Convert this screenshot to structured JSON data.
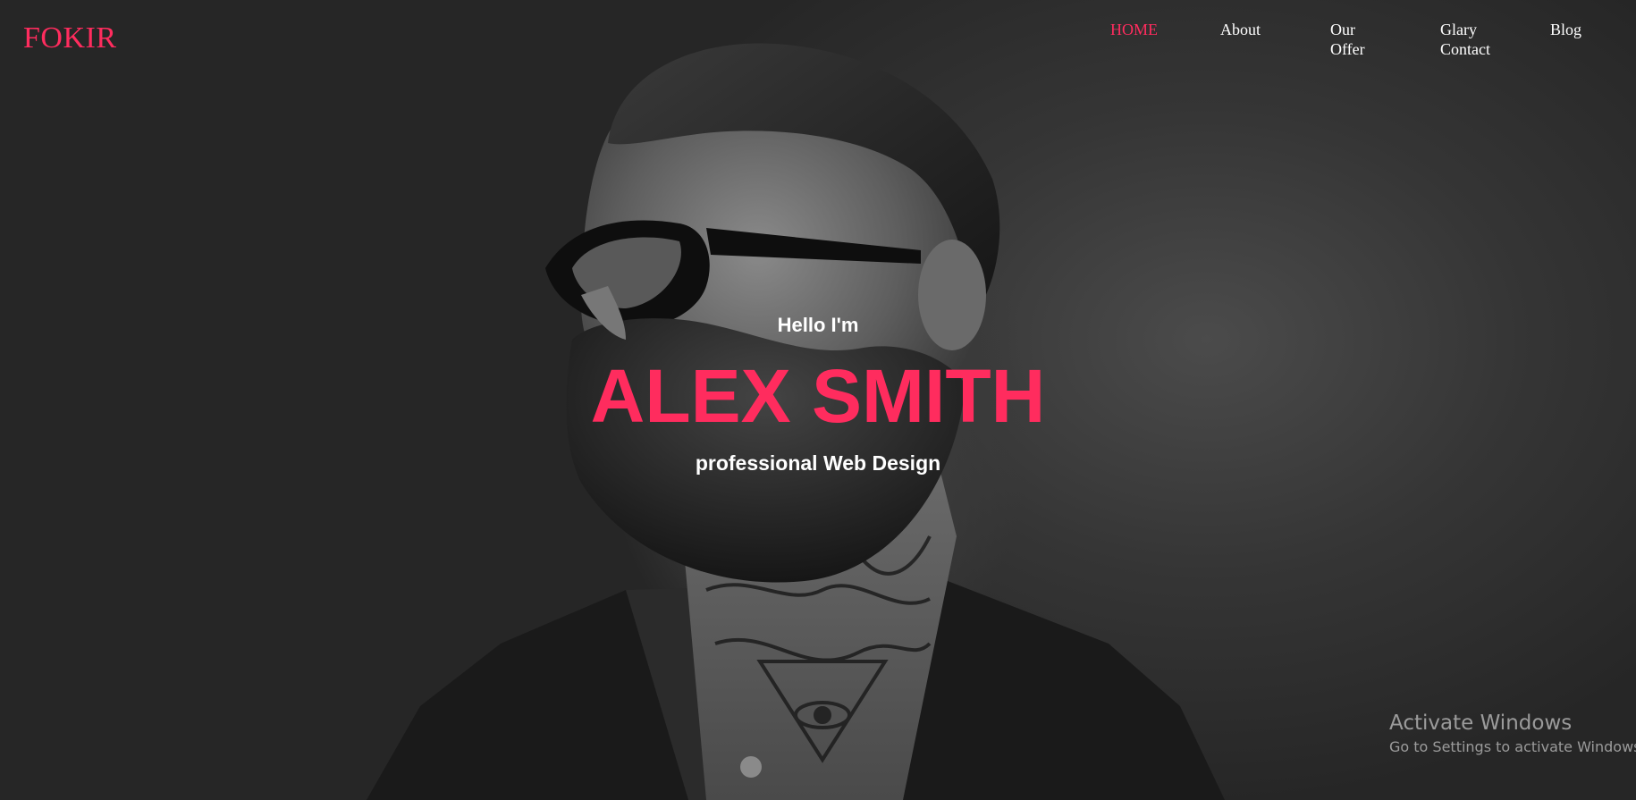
{
  "header": {
    "brand": "FOKIR",
    "nav": [
      {
        "label": "HOME",
        "active": true
      },
      {
        "label": "About",
        "active": false
      },
      {
        "label": "Our Offer",
        "active": false
      },
      {
        "label": "Glary Contact",
        "active": false
      },
      {
        "label": "Blog",
        "active": false
      }
    ]
  },
  "hero": {
    "greeting": "Hello I'm",
    "name": "ALEX SMITH",
    "tagline": "professional Web Design",
    "background_image": "grayscale-portrait-bearded-man-sunglasses-tattoos"
  },
  "os_overlay": {
    "title": "Activate Windows",
    "subtitle": "Go to Settings to activate Windows."
  },
  "colors": {
    "accent": "#ff2c5e",
    "text": "#ffffff",
    "background": "#2b2b2b"
  }
}
